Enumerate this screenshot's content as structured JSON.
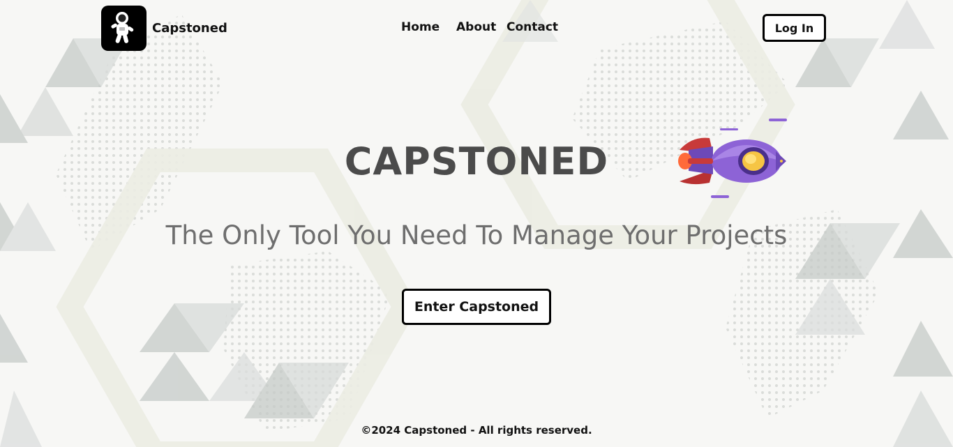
{
  "header": {
    "brand": "Capstoned",
    "logo_icon": "astronaut-icon",
    "nav": [
      {
        "label": "Home"
      },
      {
        "label": "About"
      },
      {
        "label": "Contact"
      }
    ],
    "login_label": "Log In"
  },
  "hero": {
    "title": "CAPSTONED",
    "tagline": "The Only Tool You Need To Manage Your Projects",
    "cta_label": "Enter Capstoned",
    "rocket_icon": "rocket-icon"
  },
  "footer": {
    "copyright": "©2024 Capstoned - All rights reserved."
  },
  "colors": {
    "background": "#f7f7f5",
    "hex_gray": "#c8ccc9",
    "button_border": "#000000",
    "title_text": "#4b4b4b",
    "tagline_text": "#6e6e6e",
    "rocket_body": "#8d63d6"
  }
}
